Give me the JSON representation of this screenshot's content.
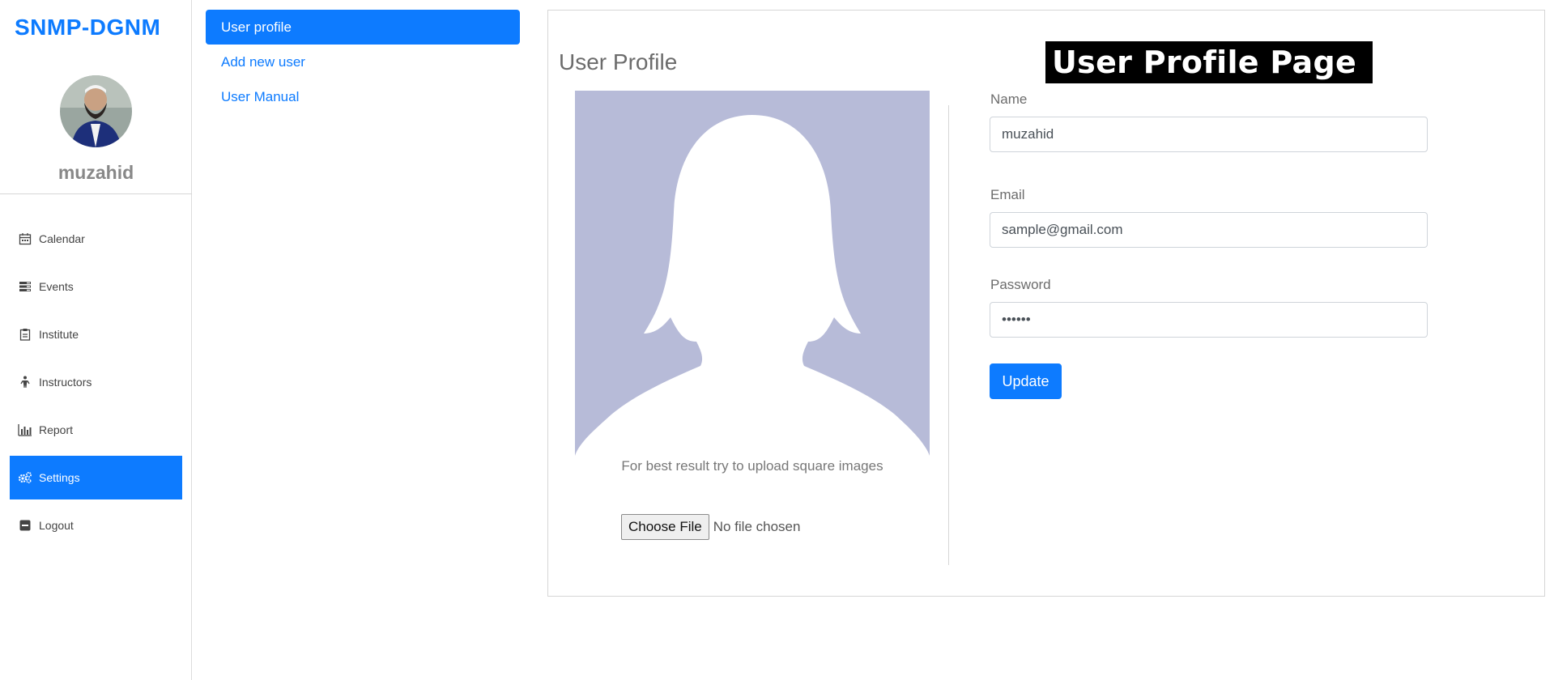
{
  "sidebar": {
    "brand": "SNMP-DGNM",
    "username": "muzahid",
    "items": [
      {
        "label": "Calendar",
        "icon": "calendar-icon"
      },
      {
        "label": "Events",
        "icon": "list-icon"
      },
      {
        "label": "Institute",
        "icon": "clipboard-icon"
      },
      {
        "label": "Instructors",
        "icon": "person-icon"
      },
      {
        "label": "Report",
        "icon": "bar-chart-icon"
      },
      {
        "label": "Settings",
        "icon": "gears-icon"
      },
      {
        "label": "Logout",
        "icon": "minus-square-icon"
      }
    ],
    "active_item": "Settings"
  },
  "submenu": {
    "items": [
      "User profile",
      "Add new user",
      "User Manual"
    ],
    "active_item": "User profile"
  },
  "main": {
    "title": "User Profile",
    "banner": "User Profile Page",
    "photo_hint": "For best result try to upload square images",
    "file_button": "Choose File",
    "file_status": "No file chosen",
    "fields": {
      "name": {
        "label": "Name",
        "value": "muzahid"
      },
      "email": {
        "label": "Email",
        "value": "sample@gmail.com"
      },
      "password": {
        "label": "Password",
        "value": "••••••"
      }
    },
    "update_label": "Update"
  },
  "colors": {
    "accent": "#0d7bff",
    "placeholder_photo_bg": "#b7bbd8",
    "banner_bg": "#000000"
  }
}
